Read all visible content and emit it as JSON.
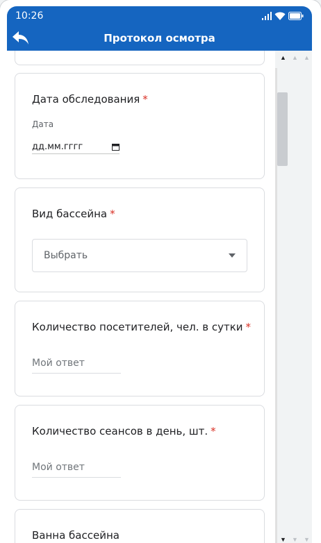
{
  "status_bar": {
    "time": "10:26"
  },
  "app_bar": {
    "title": "Протокол осмотра"
  },
  "cards": {
    "exam_date": {
      "question": "Дата обследования",
      "required": "*",
      "label": "Дата",
      "value": "дд.мм.гггг"
    },
    "pool_type": {
      "question": "Вид бассейна",
      "required": "*",
      "select_value": "Выбрать"
    },
    "visitors": {
      "question": "Количество посетителей, чел. в сутки",
      "required": "*",
      "placeholder": "Мой ответ"
    },
    "sessions": {
      "question": "Количество сеансов в день, шт.",
      "required": "*",
      "placeholder": "Мой ответ"
    },
    "pool_bath": {
      "question": "Ванна бассейна"
    }
  },
  "colors": {
    "primary": "#1565c0",
    "required": "#d93025"
  },
  "icons": {
    "back": "back-arrow-icon",
    "calendar": "calendar-icon",
    "dropdown": "dropdown-arrow-icon",
    "signal": "signal-icon",
    "wifi": "wifi-icon",
    "battery": "battery-icon"
  }
}
